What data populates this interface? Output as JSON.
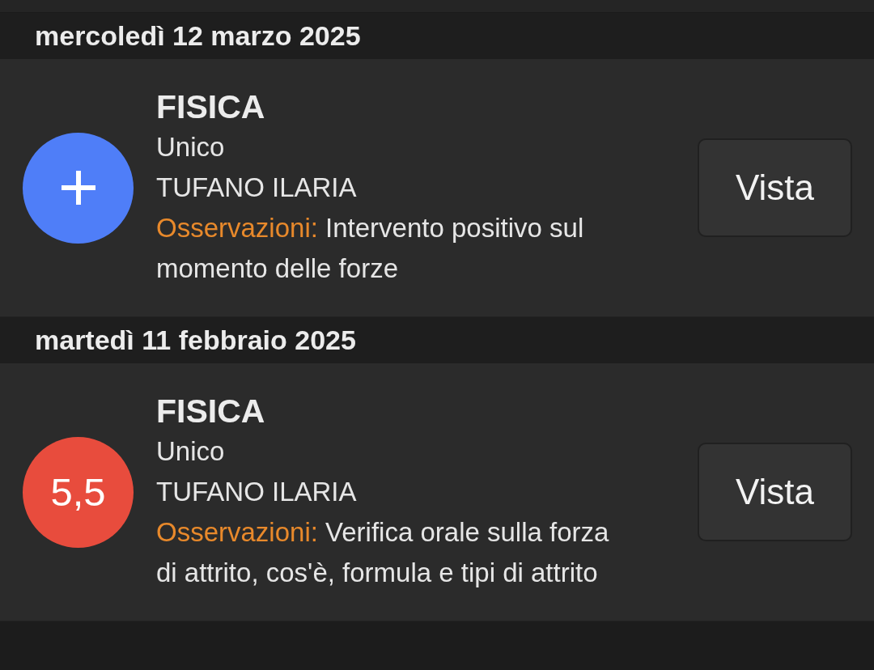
{
  "days": [
    {
      "date": "mercoledì 12 marzo 2025",
      "entries": [
        {
          "subject": "FISICA",
          "kind": "plus",
          "color": "#4f7ef8",
          "type": "Unico",
          "teacher": "TUFANO ILARIA",
          "note_label": "Osservazioni:",
          "note": "Intervento positivo sul momento delle forze",
          "button": "Vista"
        }
      ]
    },
    {
      "date": "martedì 11 febbraio 2025",
      "entries": [
        {
          "subject": "FISICA",
          "kind": "grade",
          "grade": "5,5",
          "color": "#e84c3d",
          "type": "Unico",
          "teacher": "TUFANO ILARIA",
          "note_label": "Osservazioni:",
          "note": "Verifica orale sulla forza di attrito, cos'è, formula e tipi di attrito",
          "button": "Vista"
        }
      ]
    }
  ]
}
